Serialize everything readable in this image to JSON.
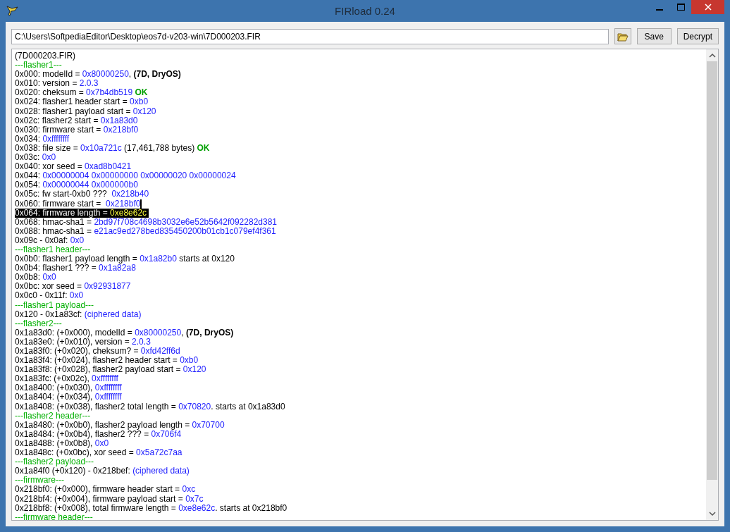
{
  "window": {
    "title": "FIRload 0.24"
  },
  "toolbar": {
    "path": "C:\\Users\\SoftpediaEditor\\Desktop\\eos7d-v203-win\\7D000203.FIR",
    "buttons": [
      "Save",
      "Decrypt"
    ]
  },
  "output": {
    "lines": [
      {
        "selected": false,
        "caret": false,
        "segments": [
          {
            "kind": "plain",
            "text": "(7D000203.FIR)"
          }
        ]
      },
      {
        "selected": false,
        "caret": false,
        "segments": [
          {
            "kind": "section",
            "text": "---flasher1---"
          }
        ]
      },
      {
        "selected": false,
        "caret": false,
        "segments": [
          {
            "kind": "plain",
            "text": "0x000: modelId = "
          },
          {
            "kind": "value",
            "text": "0x80000250"
          },
          {
            "kind": "plain",
            "text": ", "
          },
          {
            "kind": "bold",
            "text": "(7D, DryOS)"
          }
        ]
      },
      {
        "selected": false,
        "caret": false,
        "segments": [
          {
            "kind": "plain",
            "text": "0x010: version = "
          },
          {
            "kind": "value",
            "text": "2.0.3"
          }
        ]
      },
      {
        "selected": false,
        "caret": false,
        "segments": [
          {
            "kind": "plain",
            "text": "0x020: cheksum = "
          },
          {
            "kind": "value",
            "text": "0x7b4db519"
          },
          {
            "kind": "ok",
            "text": " OK"
          }
        ]
      },
      {
        "selected": false,
        "caret": false,
        "segments": [
          {
            "kind": "plain",
            "text": "0x024: flasher1 header start = "
          },
          {
            "kind": "value",
            "text": "0xb0"
          }
        ]
      },
      {
        "selected": false,
        "caret": false,
        "segments": [
          {
            "kind": "plain",
            "text": "0x028: flasher1 payload start = "
          },
          {
            "kind": "value",
            "text": "0x120"
          }
        ]
      },
      {
        "selected": false,
        "caret": false,
        "segments": [
          {
            "kind": "plain",
            "text": "0x02c: flasher2 start = "
          },
          {
            "kind": "value",
            "text": "0x1a83d0"
          }
        ]
      },
      {
        "selected": false,
        "caret": false,
        "segments": [
          {
            "kind": "plain",
            "text": "0x030: firmware start = "
          },
          {
            "kind": "value",
            "text": "0x218bf0"
          }
        ]
      },
      {
        "selected": false,
        "caret": false,
        "segments": [
          {
            "kind": "plain",
            "text": "0x034: "
          },
          {
            "kind": "value",
            "text": "0xffffffff"
          }
        ]
      },
      {
        "selected": false,
        "caret": false,
        "segments": [
          {
            "kind": "plain",
            "text": "0x038: file size = "
          },
          {
            "kind": "value",
            "text": "0x10a721c"
          },
          {
            "kind": "plain",
            "text": " (17,461,788 bytes) "
          },
          {
            "kind": "ok",
            "text": "OK"
          }
        ]
      },
      {
        "selected": false,
        "caret": false,
        "segments": [
          {
            "kind": "plain",
            "text": "0x03c: "
          },
          {
            "kind": "value",
            "text": "0x0"
          }
        ]
      },
      {
        "selected": false,
        "caret": false,
        "segments": [
          {
            "kind": "plain",
            "text": "0x040: xor seed = "
          },
          {
            "kind": "value",
            "text": "0xad8b0421"
          }
        ]
      },
      {
        "selected": false,
        "caret": false,
        "segments": [
          {
            "kind": "plain",
            "text": "0x044: "
          },
          {
            "kind": "value",
            "text": "0x00000004 0x00000000 0x00000020 0x00000024"
          }
        ]
      },
      {
        "selected": false,
        "caret": false,
        "segments": [
          {
            "kind": "plain",
            "text": "0x054: "
          },
          {
            "kind": "value",
            "text": "0x00000044 0x000000b0"
          }
        ]
      },
      {
        "selected": false,
        "caret": false,
        "segments": [
          {
            "kind": "plain",
            "text": "0x05c: fw start-0xb0 ???  "
          },
          {
            "kind": "value",
            "text": "0x218b40"
          }
        ]
      },
      {
        "selected": false,
        "caret": true,
        "segments": [
          {
            "kind": "plain",
            "text": "0x060: firmware start =  "
          },
          {
            "kind": "value",
            "text": "0x218bf0"
          }
        ]
      },
      {
        "selected": true,
        "caret": false,
        "segments": [
          {
            "kind": "plain",
            "text": "0x064: firmware length = "
          },
          {
            "kind": "value",
            "text": "0xe8e62c"
          }
        ]
      },
      {
        "selected": false,
        "caret": false,
        "segments": [
          {
            "kind": "plain",
            "text": "0x068: hmac-sha1 = "
          },
          {
            "kind": "value",
            "text": "2bd97f708c4698b3032e6e52b5642f092282d381"
          }
        ]
      },
      {
        "selected": false,
        "caret": false,
        "segments": [
          {
            "kind": "plain",
            "text": "0x088: hmac-sha1 = "
          },
          {
            "kind": "value",
            "text": "e21ac9ed278bed835450200b01cb1c079ef4f361"
          }
        ]
      },
      {
        "selected": false,
        "caret": false,
        "segments": [
          {
            "kind": "plain",
            "text": "0x09c - 0x0af: "
          },
          {
            "kind": "value",
            "text": "0x0"
          }
        ]
      },
      {
        "selected": false,
        "caret": false,
        "segments": [
          {
            "kind": "section",
            "text": "---flasher1 header---"
          }
        ]
      },
      {
        "selected": false,
        "caret": false,
        "segments": [
          {
            "kind": "plain",
            "text": "0x0b0: flasher1 payload length = "
          },
          {
            "kind": "value",
            "text": "0x1a82b0"
          },
          {
            "kind": "plain",
            "text": " starts at 0x120"
          }
        ]
      },
      {
        "selected": false,
        "caret": false,
        "segments": [
          {
            "kind": "plain",
            "text": "0x0b4: flasher1 ??? = "
          },
          {
            "kind": "value",
            "text": "0x1a82a8"
          }
        ]
      },
      {
        "selected": false,
        "caret": false,
        "segments": [
          {
            "kind": "plain",
            "text": "0x0b8: "
          },
          {
            "kind": "value",
            "text": "0x0"
          }
        ]
      },
      {
        "selected": false,
        "caret": false,
        "segments": [
          {
            "kind": "plain",
            "text": "0x0bc: xor seed = "
          },
          {
            "kind": "value",
            "text": "0x92931877"
          }
        ]
      },
      {
        "selected": false,
        "caret": false,
        "segments": [
          {
            "kind": "plain",
            "text": "0x0c0 - 0x11f: "
          },
          {
            "kind": "value",
            "text": "0x0"
          }
        ]
      },
      {
        "selected": false,
        "caret": false,
        "segments": [
          {
            "kind": "section",
            "text": "---flasher1 payload---"
          }
        ]
      },
      {
        "selected": false,
        "caret": false,
        "segments": [
          {
            "kind": "plain",
            "text": "0x120 - 0x1a83cf: "
          },
          {
            "kind": "value",
            "text": "(ciphered data)"
          }
        ]
      },
      {
        "selected": false,
        "caret": false,
        "segments": [
          {
            "kind": "section",
            "text": "---flasher2---"
          }
        ]
      },
      {
        "selected": false,
        "caret": false,
        "segments": [
          {
            "kind": "plain",
            "text": "0x1a83d0: (+0x000), modelId = "
          },
          {
            "kind": "value",
            "text": "0x80000250"
          },
          {
            "kind": "plain",
            "text": ", "
          },
          {
            "kind": "bold",
            "text": "(7D, DryOS)"
          }
        ]
      },
      {
        "selected": false,
        "caret": false,
        "segments": [
          {
            "kind": "plain",
            "text": "0x1a83e0: (+0x010), version = "
          },
          {
            "kind": "value",
            "text": "2.0.3"
          }
        ]
      },
      {
        "selected": false,
        "caret": false,
        "segments": [
          {
            "kind": "plain",
            "text": "0x1a83f0: (+0x020), cheksum? = "
          },
          {
            "kind": "value",
            "text": "0xfd42ff6d"
          }
        ]
      },
      {
        "selected": false,
        "caret": false,
        "segments": [
          {
            "kind": "plain",
            "text": "0x1a83f4: (+0x024), flasher2 header start = "
          },
          {
            "kind": "value",
            "text": "0xb0"
          }
        ]
      },
      {
        "selected": false,
        "caret": false,
        "segments": [
          {
            "kind": "plain",
            "text": "0x1a83f8: (+0x028), flasher2 payload start = "
          },
          {
            "kind": "value",
            "text": "0x120"
          }
        ]
      },
      {
        "selected": false,
        "caret": false,
        "segments": [
          {
            "kind": "plain",
            "text": "0x1a83fc: (+0x02c), "
          },
          {
            "kind": "value",
            "text": "0xffffffff"
          }
        ]
      },
      {
        "selected": false,
        "caret": false,
        "segments": [
          {
            "kind": "plain",
            "text": "0x1a8400: (+0x030), "
          },
          {
            "kind": "value",
            "text": "0xffffffff"
          }
        ]
      },
      {
        "selected": false,
        "caret": false,
        "segments": [
          {
            "kind": "plain",
            "text": "0x1a8404: (+0x034), "
          },
          {
            "kind": "value",
            "text": "0xffffffff"
          }
        ]
      },
      {
        "selected": false,
        "caret": false,
        "segments": [
          {
            "kind": "plain",
            "text": "0x1a8408: (+0x038), flasher2 total length = "
          },
          {
            "kind": "value",
            "text": "0x70820"
          },
          {
            "kind": "plain",
            "text": ". starts at 0x1a83d0"
          }
        ]
      },
      {
        "selected": false,
        "caret": false,
        "segments": [
          {
            "kind": "section",
            "text": "---flasher2 header---"
          }
        ]
      },
      {
        "selected": false,
        "caret": false,
        "segments": [
          {
            "kind": "plain",
            "text": "0x1a8480: (+0x0b0), flasher2 payload length = "
          },
          {
            "kind": "value",
            "text": "0x70700"
          }
        ]
      },
      {
        "selected": false,
        "caret": false,
        "segments": [
          {
            "kind": "plain",
            "text": "0x1a8484: (+0x0b4), flasher2 ??? = "
          },
          {
            "kind": "value",
            "text": "0x706f4"
          }
        ]
      },
      {
        "selected": false,
        "caret": false,
        "segments": [
          {
            "kind": "plain",
            "text": "0x1a8488: (+0x0b8), "
          },
          {
            "kind": "value",
            "text": "0x0"
          }
        ]
      },
      {
        "selected": false,
        "caret": false,
        "segments": [
          {
            "kind": "plain",
            "text": "0x1a848c: (+0x0bc), xor seed = "
          },
          {
            "kind": "value",
            "text": "0x5a72c7aa"
          }
        ]
      },
      {
        "selected": false,
        "caret": false,
        "segments": [
          {
            "kind": "section",
            "text": "---flasher2 payload---"
          }
        ]
      },
      {
        "selected": false,
        "caret": false,
        "segments": [
          {
            "kind": "plain",
            "text": "0x1a84f0 (+0x120) - 0x218bef: "
          },
          {
            "kind": "value",
            "text": "(ciphered data)"
          }
        ]
      },
      {
        "selected": false,
        "caret": false,
        "segments": [
          {
            "kind": "section",
            "text": "---firmware---"
          }
        ]
      },
      {
        "selected": false,
        "caret": false,
        "segments": [
          {
            "kind": "plain",
            "text": "0x218bf0: (+0x000), firmware header start = "
          },
          {
            "kind": "value",
            "text": "0xc"
          }
        ]
      },
      {
        "selected": false,
        "caret": false,
        "segments": [
          {
            "kind": "plain",
            "text": "0x218bf4: (+0x004), firmware payload start = "
          },
          {
            "kind": "value",
            "text": "0x7c"
          }
        ]
      },
      {
        "selected": false,
        "caret": false,
        "segments": [
          {
            "kind": "plain",
            "text": "0x218bf8: (+0x008), total firmware length = "
          },
          {
            "kind": "value",
            "text": "0xe8e62c"
          },
          {
            "kind": "plain",
            "text": ". starts at 0x218bf0"
          }
        ]
      },
      {
        "selected": false,
        "caret": false,
        "segments": [
          {
            "kind": "section",
            "text": "---firmware header---"
          }
        ]
      }
    ]
  }
}
